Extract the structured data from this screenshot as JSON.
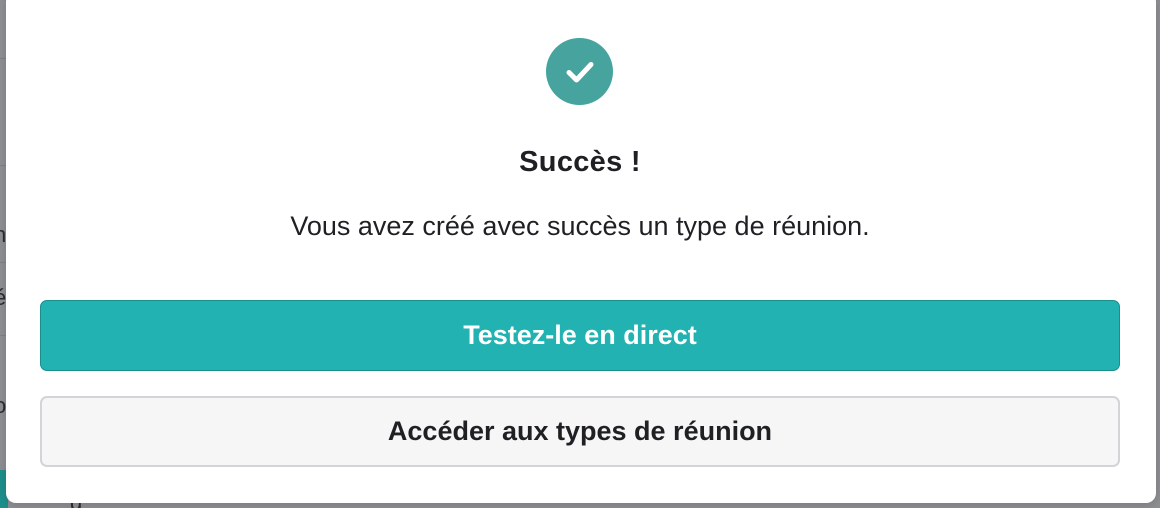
{
  "dialog": {
    "title": "Succès !",
    "message": "Vous avez créé avec succès un type de réunion.",
    "primary_button": "Testez-le en direct",
    "secondary_button": "Accéder aux types de réunion",
    "icon": "check-circle-icon"
  },
  "colors": {
    "accent": "#21b2b1",
    "success_icon": "#46a39d",
    "text": "#1f2024",
    "secondary_bg": "#f6f6f7"
  },
  "background": {
    "partial_glyphs": [
      "n",
      "é",
      "o",
      "g"
    ]
  }
}
